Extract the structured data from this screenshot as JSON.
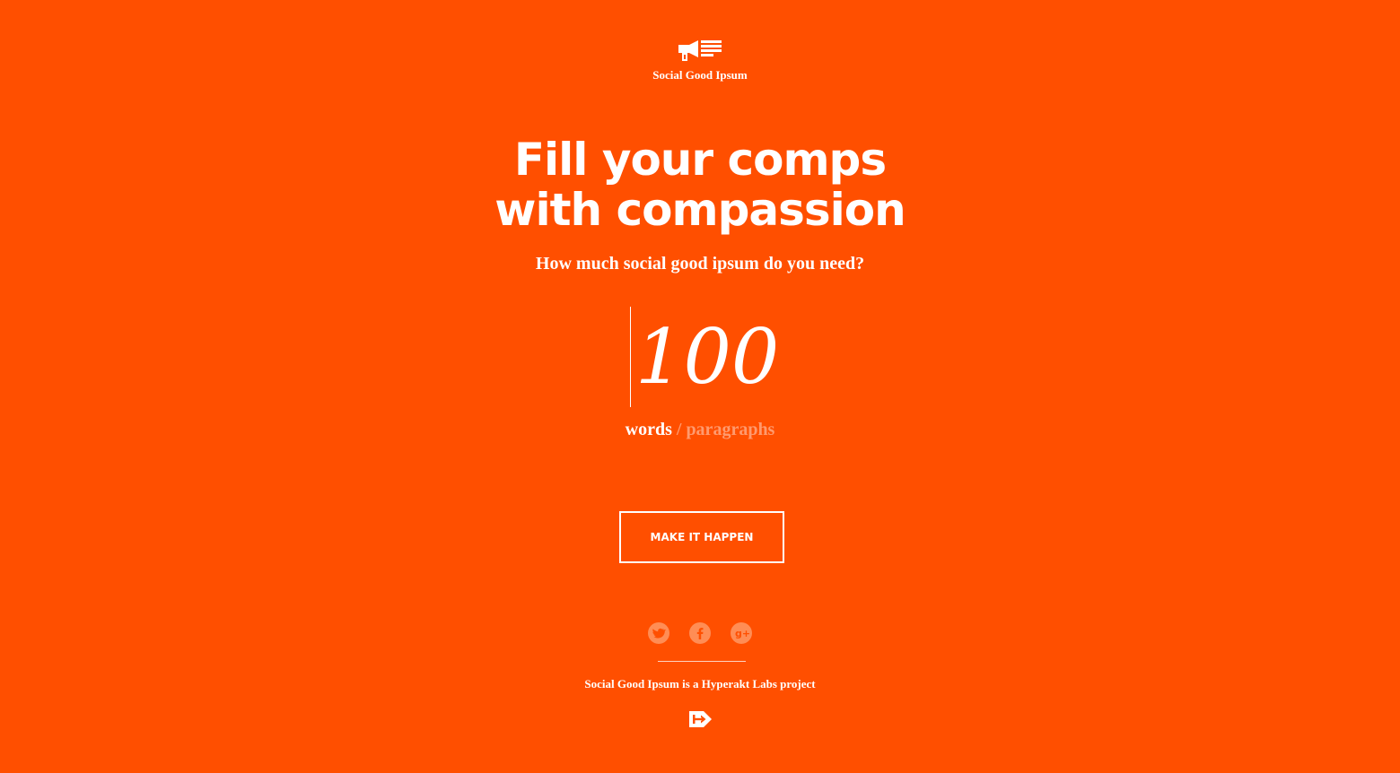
{
  "brand": {
    "name": "Social Good Ipsum",
    "logo_icon": "megaphone-document-icon"
  },
  "hero": {
    "headline_line1": "Fill your comps",
    "headline_line2": "with compassion",
    "subhead": "How much social good ipsum do you need?"
  },
  "generator": {
    "count_value": "100",
    "unit_words": "words",
    "unit_separator": " / ",
    "unit_paragraphs": "paragraphs",
    "selected_unit": "words",
    "button_label": "MAKE IT HAPPEN"
  },
  "social": {
    "icons": [
      "twitter-icon",
      "facebook-icon",
      "google-plus-icon"
    ]
  },
  "footer": {
    "credit": "Social Good Ipsum is a Hyperakt Labs project",
    "logo_icon": "hyperakt-logo-icon"
  },
  "colors": {
    "background": "#ff4f00",
    "text": "#ffffff",
    "muted": "#ff9a6e",
    "social_circle": "#ff8d55"
  }
}
